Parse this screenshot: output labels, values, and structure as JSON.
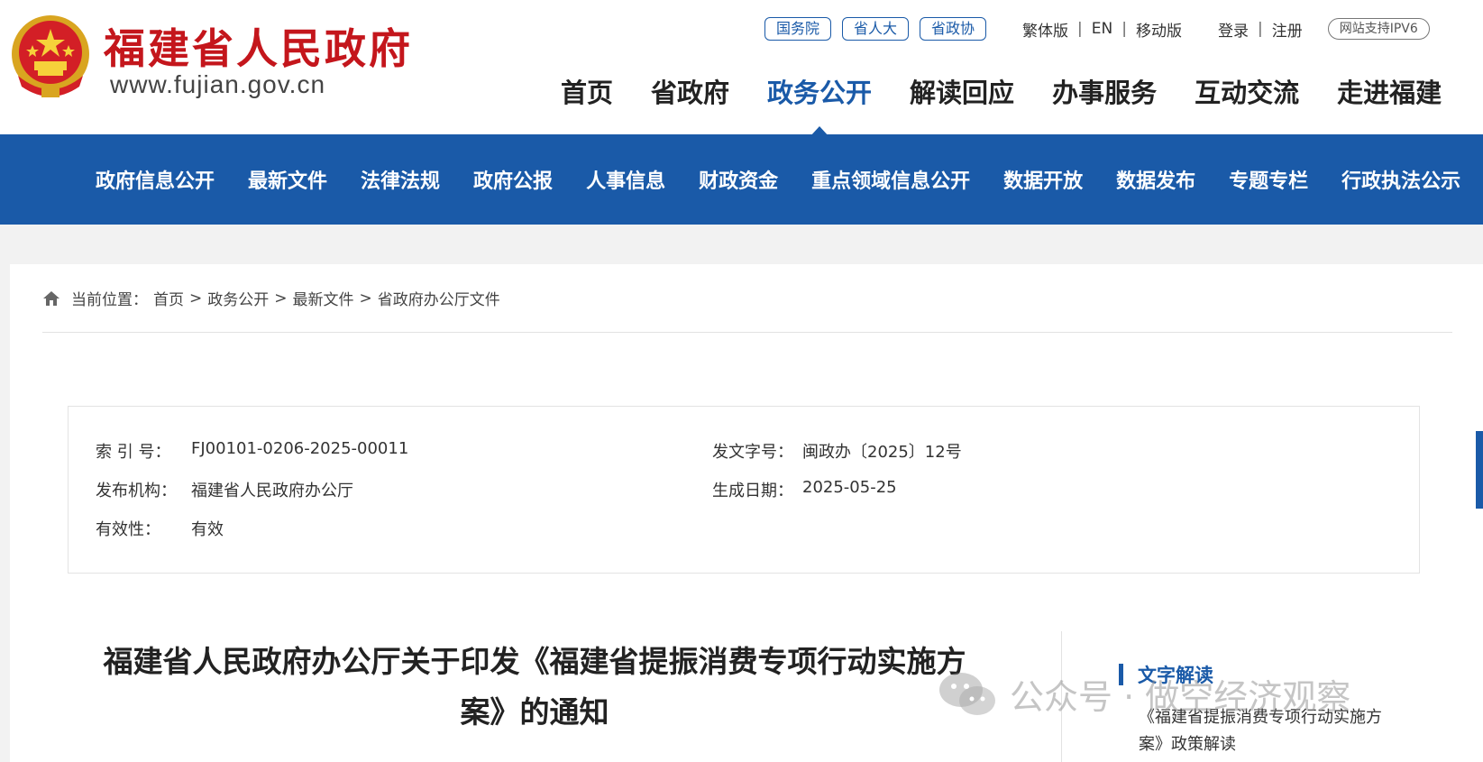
{
  "header": {
    "site_name": "福建省人民政府",
    "site_url": "www.fujian.gov.cn",
    "top_pills": [
      "国务院",
      "省人大",
      "省政协"
    ],
    "lang_links": [
      "繁体版",
      "EN",
      "移动版"
    ],
    "account_links": [
      "登录",
      "注册"
    ],
    "ipv6_badge": "网站支持IPV6",
    "main_nav": [
      "首页",
      "省政府",
      "政务公开",
      "解读回应",
      "办事服务",
      "互动交流",
      "走进福建"
    ],
    "active_nav": "政务公开"
  },
  "sub_nav": [
    "政府信息公开",
    "最新文件",
    "法律法规",
    "政府公报",
    "人事信息",
    "财政资金",
    "重点领域信息公开",
    "数据开放",
    "数据发布",
    "专题专栏",
    "行政执法公示"
  ],
  "breadcrumb": {
    "label": "当前位置：",
    "items": [
      "首页",
      "政务公开",
      "最新文件",
      "省政府办公厅文件"
    ],
    "separator": ">"
  },
  "meta": {
    "index_label": "索 引 号：",
    "index_value": "FJ00101-0206-2025-00011",
    "doc_no_label": "发文字号：",
    "doc_no_value": "闽政办〔2025〕12号",
    "issuer_label": "发布机构：",
    "issuer_value": "福建省人民政府办公厅",
    "date_label": "生成日期：",
    "date_value": "2025-05-25",
    "validity_label": "有效性：",
    "validity_value": "有效"
  },
  "document": {
    "title_line1": "福建省人民政府办公厅关于印发《福建省提振消费专项行动实施方",
    "title_line2": "案》的通知"
  },
  "sidebar": {
    "heading": "文字解读",
    "item_line1": "《福建省提振消费专项行动实施方",
    "item_line2": "案》政策解读"
  },
  "watermark": {
    "text": "公众号 · 做空经济观察"
  },
  "colors": {
    "brand_blue": "#1a5aa8",
    "brand_red": "#c4161c"
  }
}
